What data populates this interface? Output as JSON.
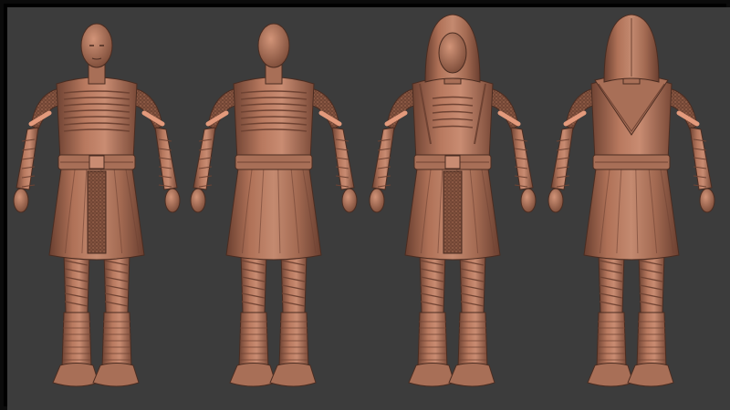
{
  "scene": {
    "background_color": "#3c3c3c",
    "frame_color": "#0b0b0b",
    "material": {
      "base": "#a86f57",
      "light": "#c98c72",
      "dark": "#6f4333",
      "shadow": "#4a2c21",
      "accent": "#e39a7c"
    },
    "figures": [
      {
        "id": "figure-1",
        "hood": "down",
        "facing": "front-three-quarter"
      },
      {
        "id": "figure-2",
        "hood": "down",
        "facing": "back"
      },
      {
        "id": "figure-3",
        "hood": "up",
        "facing": "front-three-quarter"
      },
      {
        "id": "figure-4",
        "hood": "up",
        "facing": "back"
      }
    ]
  }
}
